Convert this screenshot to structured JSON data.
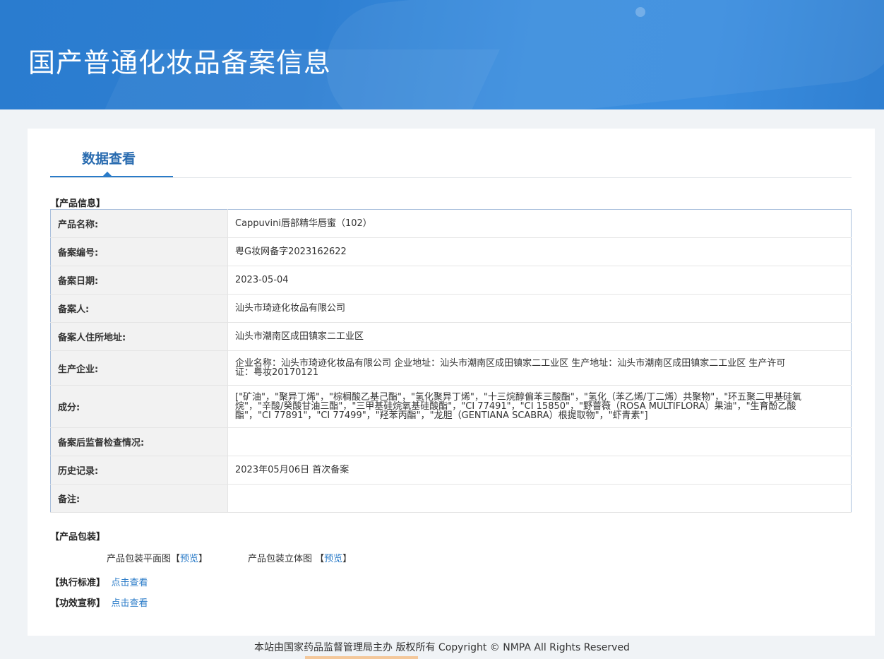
{
  "header": {
    "title": "国产普通化妆品备案信息"
  },
  "tab": {
    "label": "数据查看"
  },
  "product_info": {
    "section_title": "【产品信息】",
    "rows": [
      {
        "key": "产品名称:",
        "value": "Cappuvini唇部精华唇蜜（102）"
      },
      {
        "key": "备案编号:",
        "value": "粤G妆网备字2023162622"
      },
      {
        "key": "备案日期:",
        "value": "2023-05-04"
      },
      {
        "key": "备案人:",
        "value": "汕头市琦迹化妆品有限公司"
      },
      {
        "key": "备案人住所地址:",
        "value": "汕头市潮南区成田镇家二工业区"
      },
      {
        "key": "生产企业:",
        "value": "企业名称：汕头市琦迹化妆品有限公司 企业地址：汕头市潮南区成田镇家二工业区 生产地址：汕头市潮南区成田镇家二工业区 生产许可证：粤妆20170121"
      },
      {
        "key": "成分:",
        "value": "[\"矿油\"，\"聚异丁烯\"，\"棕榈酸乙基己酯\"，\"氢化聚异丁烯\"，\"十三烷醇偏苯三酸酯\"，\"氢化（苯乙烯/丁二烯）共聚物\"，\"环五聚二甲基硅氧烷\"，\"辛酸/癸酸甘油三酯\"，\"三甲基硅烷氧基硅酸酯\"，\"CI 77491\"，\"CI 15850\"，\"野蔷薇（ROSA MULTIFLORA）果油\"，\"生育酚乙酸酯\"，\"CI 77891\"，\"CI 77499\"，\"羟苯丙酯\"，\"龙胆（GENTIANA SCABRA）根提取物\"，\"虾青素\"]"
      },
      {
        "key": "备案后监督检查情况:",
        "value": ""
      },
      {
        "key": "历史记录:",
        "value": "2023年05月06日 首次备案"
      },
      {
        "key": "备注:",
        "value": ""
      }
    ]
  },
  "packaging": {
    "section_title": "【产品包装】",
    "flat_label": "产品包装平面图",
    "flat_preview": "预览",
    "solid_label": "产品包装立体图",
    "solid_preview": "预览"
  },
  "standard": {
    "label": "【执行标准】",
    "link": "点击查看"
  },
  "efficacy": {
    "label": "【功效宣称】",
    "link": "点击查看"
  },
  "footer": {
    "text": "本站由国家药品监督管理局主办 版权所有 Copyright © NMPA All Rights Reserved"
  }
}
